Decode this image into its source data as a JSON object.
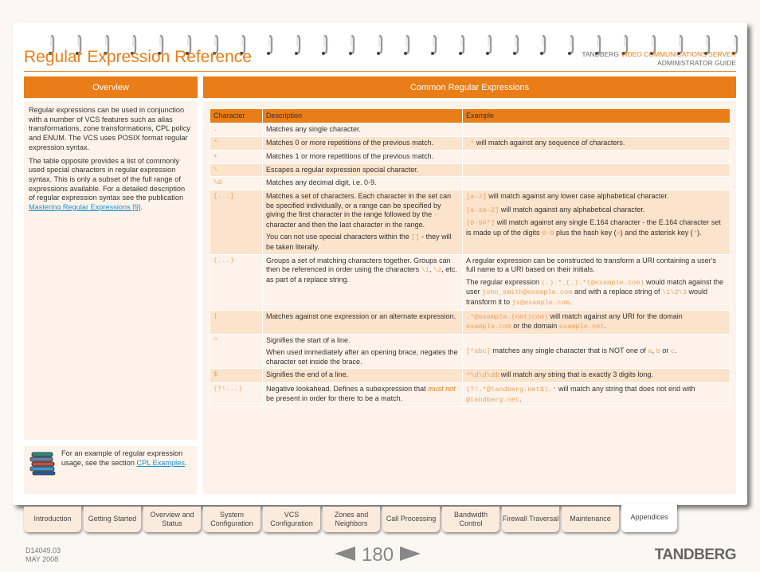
{
  "header": {
    "title": "Regular Expression Reference",
    "brand_prefix": "TANDBERG",
    "brand_accent": "VIDEO COMMUNICATIONS SERVER",
    "brand_sub": "ADMINISTRATOR GUIDE"
  },
  "colors": {
    "accent": "#e97d17",
    "link": "#1a8fd0",
    "panel": "#fdf3ea",
    "row_alt": "#fbe3cc"
  },
  "left": {
    "heading": "Overview",
    "para1": "Regular expressions can be used in conjunction with a number of VCS features such as alias transformations, zone transformations, CPL policy and ENUM. The VCS uses POSIX format regular expression syntax.",
    "para2": "The table opposite provides a list of commonly used special characters in regular expression syntax.  This is only a subset of the full range of expressions available.  For a detailed description of regular expression syntax see the publication ",
    "para2_link": "Mastering Regular Expressions [9]",
    "para2_end": ".",
    "note_icon": "books-icon",
    "note_text": "For an example of regular expression usage, see the section ",
    "note_link": "CPL Examples",
    "note_end": "."
  },
  "right": {
    "heading": "Common Regular Expressions",
    "columns": [
      "Character",
      "Description",
      "Example"
    ],
    "rows": [
      {
        "char": ".",
        "desc": "Matches any single character.",
        "ex": ""
      },
      {
        "char": "*",
        "desc": "Matches 0 or more repetitions of the previous match.",
        "ex_code": ".*",
        "ex": " will match against any sequence of characters."
      },
      {
        "char": "+",
        "desc": "Matches 1 or more repetitions of the previous match.",
        "ex": ""
      },
      {
        "char": "\\",
        "desc": "Escapes a regular expression special character.",
        "ex": ""
      },
      {
        "char": "\\d",
        "desc": "Matches any decimal digit, i.e. 0-9.",
        "ex": ""
      },
      {
        "char": "[...]",
        "desc_a": "Matches a set of characters. Each character in the set can be specified individually, or a range can be specified by giving the first character in the range followed by the ",
        "desc_a_code": "-",
        "desc_a_end": " character and then the last character in the range.",
        "desc_b": "You can not use special characters within the ",
        "desc_b_code": "[]",
        "desc_b_end": " - they will be taken literally.",
        "ex1_code": "[a-z]",
        "ex1": " will match against any lower case alphabetical character.",
        "ex2_code": "[a-zA-Z]",
        "ex2": " will match against any alphabetical character.",
        "ex3_code": "[0-9#*]",
        "ex3": " will match against any single E.164 character - the E.164 character set is made up of the digits ",
        "ex3_code2": "0-9",
        "ex3_mid": " plus the hash key (",
        "ex3_code3": "#",
        "ex3_mid2": ") and the asterisk key (",
        "ex3_code4": "*",
        "ex3_end": ")."
      },
      {
        "char": "(...)",
        "desc": "Groups a set of matching characters together. Groups can then be referenced in order using the characters ",
        "desc_code1": "\\1",
        "desc_mid": ", ",
        "desc_code2": "\\2",
        "desc_end": ", etc. as part of a replace string.",
        "ex1": "A regular expression can be constructed to transform a URI containing a user's full name to a URI based on their initials.",
        "ex2_a": "The regular expression ",
        "ex2_code1": "(.).*_(.).*(@example.com)",
        "ex2_b": " would match against the user ",
        "ex2_code2": "john_smith@example.com",
        "ex2_c": " and with a replace string of ",
        "ex2_code3": "\\1\\2\\3",
        "ex2_d": " would transform it to ",
        "ex2_code4": "js@example.com",
        "ex2_e": "."
      },
      {
        "char": "|",
        "desc": "Matches against one expression or an alternate expression.",
        "ex_code": ".*@example.(net|com)",
        "ex": " will match against any URI for the domain ",
        "ex_code2": "example.com",
        "ex_mid": " or the domain ",
        "ex_code3": "example.net",
        "ex_end": "."
      },
      {
        "char": "^",
        "desc_a": "Signifies the start of a line.",
        "desc_b": "When used immediately after an opening brace, negates the character set inside the brace.",
        "ex_code": "[^abc]",
        "ex": " matches any single character that is NOT one of ",
        "ex_code2": "a",
        "ex_mid": ", ",
        "ex_code3": "b",
        "ex_mid2": " or ",
        "ex_code4": "c",
        "ex_end": "."
      },
      {
        "char": "$",
        "desc": "Signifies the end of a line.",
        "ex_code": "^\\d\\d\\d$",
        "ex": " will match any string that is exactly 3 digits long."
      },
      {
        "char": "(?!...)",
        "desc_a": "Negative lookahead.  Defines a subexpression that ",
        "desc_em": "must not",
        "desc_end": " be present in order for there to be a match.",
        "ex_code": "(?!.*@tandberg.net$).*",
        "ex": " will match any string that does not end with ",
        "ex_code2": "@tandberg.net",
        "ex_end": "."
      }
    ]
  },
  "nav": {
    "tabs": [
      "Introduction",
      "Getting Started",
      "Overview and Status",
      "System Configuration",
      "VCS Configuration",
      "Zones and Neighbors",
      "Call Processing",
      "Bandwidth Control",
      "Firewall Traversal",
      "Maintenance",
      "Appendices"
    ],
    "active": "Appendices"
  },
  "footer": {
    "doc_id": "D14049.03",
    "date": "MAY 2008",
    "page_number": "180",
    "prev_icon": "prev-page-icon",
    "next_icon": "next-page-icon",
    "logo": "TANDBERG"
  }
}
